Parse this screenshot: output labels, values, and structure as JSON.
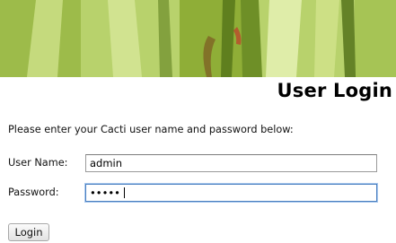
{
  "page": {
    "title": "User Login",
    "instructions": "Please enter your Cacti user name and password below:"
  },
  "form": {
    "username_label": "User Name:",
    "username_value": "admin",
    "password_label": "Password:",
    "password_value": "•••••",
    "login_label": "Login"
  },
  "colors": {
    "banner_green": "#a9c65b",
    "focus_border": "#4a7fc0"
  }
}
